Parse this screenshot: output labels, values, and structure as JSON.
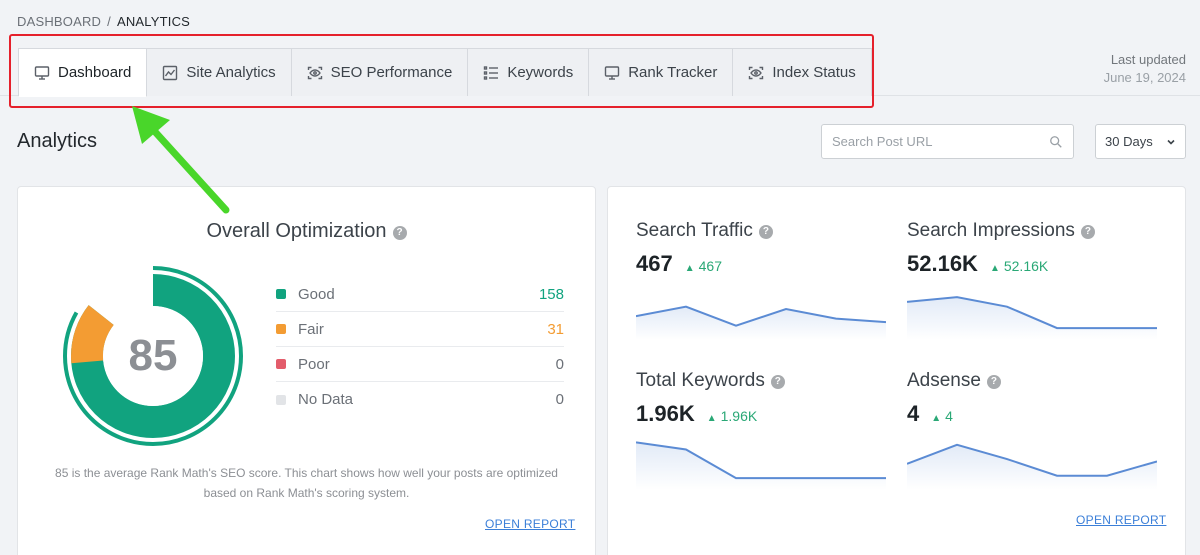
{
  "breadcrumb": {
    "root": "DASHBOARD",
    "separator": "/",
    "current": "ANALYTICS"
  },
  "tabs": [
    {
      "label": "Dashboard",
      "icon": "monitor-icon",
      "active": true
    },
    {
      "label": "Site Analytics",
      "icon": "line-chart-icon",
      "active": false
    },
    {
      "label": "SEO Performance",
      "icon": "eye-scan-icon",
      "active": false
    },
    {
      "label": "Keywords",
      "icon": "list-icon",
      "active": false
    },
    {
      "label": "Rank Tracker",
      "icon": "monitor-icon",
      "active": false
    },
    {
      "label": "Index Status",
      "icon": "eye-scan-icon",
      "active": false
    }
  ],
  "last_updated": {
    "label": "Last updated",
    "date": "June 19, 2024"
  },
  "page_title": "Analytics",
  "search": {
    "placeholder": "Search Post URL",
    "value": ""
  },
  "date_range": {
    "selected": "30 Days"
  },
  "optimization": {
    "title": "Overall Optimization",
    "score": "85",
    "legend": [
      {
        "label": "Good",
        "value": "158",
        "color": "#11a37f",
        "value_color": "#11a37f"
      },
      {
        "label": "Fair",
        "value": "31",
        "color": "#f39c33",
        "value_color": "#f39c33"
      },
      {
        "label": "Poor",
        "value": "0",
        "color": "#e35c6b",
        "value_color": "#6b7077"
      },
      {
        "label": "No Data",
        "value": "0",
        "color": "#e2e4e7",
        "value_color": "#6b7077"
      }
    ],
    "description": "85 is the average Rank Math's SEO score. This chart shows how well your posts are optimized based on Rank Math's scoring system.",
    "open_report": "OPEN REPORT"
  },
  "metrics": [
    {
      "label": "Search Traffic",
      "value": "467",
      "delta": "467",
      "spark": [
        20,
        28,
        12,
        26,
        18,
        15
      ]
    },
    {
      "label": "Search Impressions",
      "value": "52.16K",
      "delta": "52.16K",
      "spark": [
        32,
        36,
        28,
        10,
        10,
        10
      ]
    },
    {
      "label": "Total Keywords",
      "value": "1.96K",
      "delta": "1.96K",
      "spark": [
        40,
        34,
        10,
        10,
        10,
        10
      ]
    },
    {
      "label": "Adsense",
      "value": "4",
      "delta": "4",
      "spark": [
        22,
        38,
        26,
        12,
        12,
        24
      ]
    }
  ],
  "metrics_open_report": "OPEN REPORT",
  "colors": {
    "good": "#11a37f",
    "fair": "#f39c33",
    "spark_line": "#5b8bd4",
    "highlight": "#e5202b",
    "arrow": "#49d62a"
  }
}
